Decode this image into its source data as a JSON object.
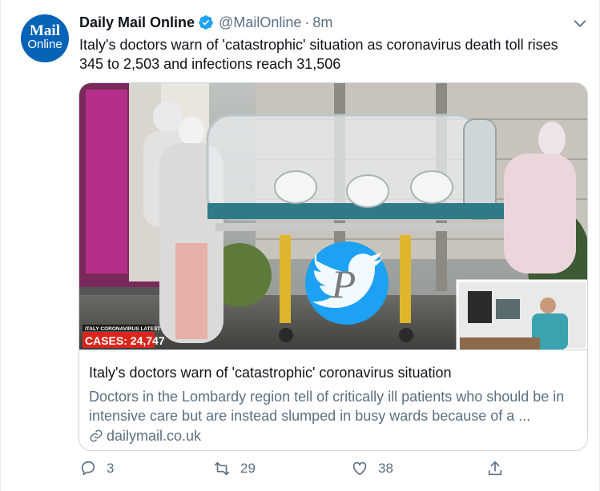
{
  "author": {
    "avatar_line1": "Mail",
    "avatar_line2": "Online",
    "name": "Daily Mail Online",
    "handle": "@MailOnline",
    "separator": "·",
    "time": "8m"
  },
  "tweet_text": "Italy's doctors warn of 'catastrophic' situation as coronavirus death toll rises 345 to 2,503 and infections reach 31,506",
  "card": {
    "overlay_label": "ITALY CORONAVIRUS LATEST",
    "overlay_cases": "CASES: 24,747",
    "watermark_letter": "P",
    "title": "Italy's doctors warn of 'catastrophic' coronavirus situation",
    "description": "Doctors in the Lombardy region tell of critically ill patients who should be in intensive care but are instead slumped in busy wards because of a ...",
    "domain": "dailymail.co.uk"
  },
  "actions": {
    "reply_count": "3",
    "retweet_count": "29",
    "like_count": "38"
  },
  "colors": {
    "verified": "#1da1f2",
    "twitter_blue": "#1da1f2",
    "secondary_text": "#5b7083",
    "avatar_bg": "#0563b7",
    "cases_red": "#d9261c"
  }
}
